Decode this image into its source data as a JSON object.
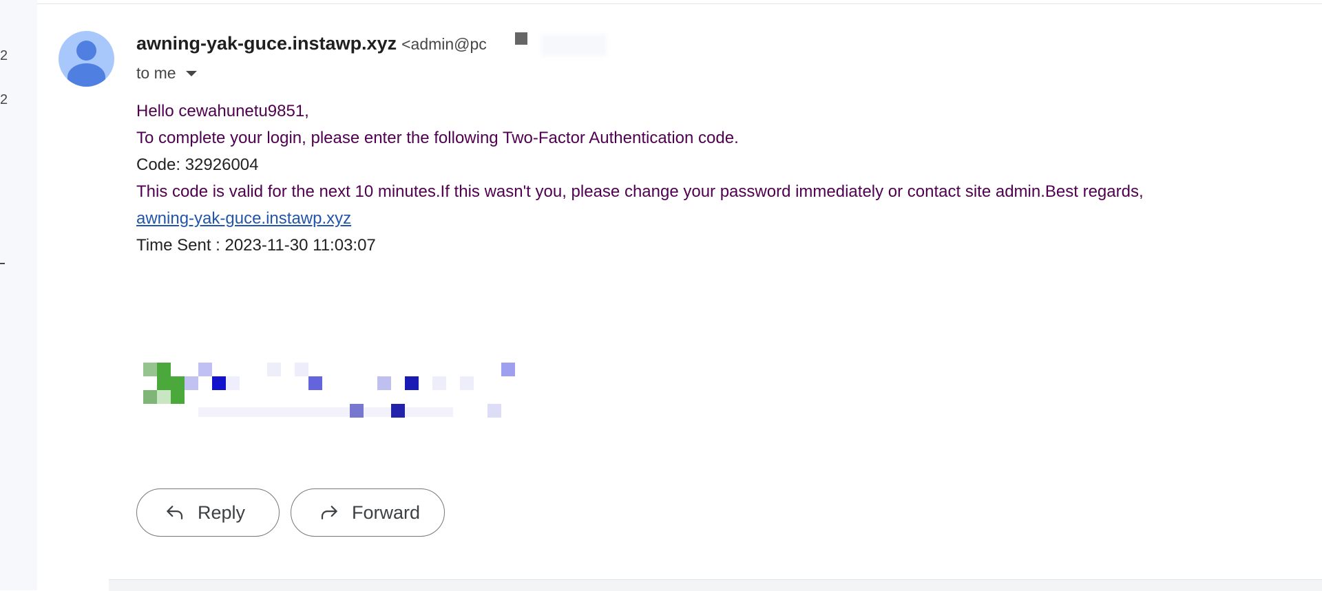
{
  "sidebar": {
    "marks": [
      "2",
      "2"
    ]
  },
  "email": {
    "sender_name": "awning-yak-guce.instawp.xyz",
    "sender_email": "<admin@pc",
    "recipient_label": "to me",
    "body": {
      "greeting": "Hello cewahunetu9851,",
      "instruction": "To complete your login, please enter the following Two-Factor Authentication code.",
      "code_line": "Code: 32926004",
      "validity": "This code is valid for the next 10 minutes.If this wasn't you, please change your password immediately or contact site admin.Best regards,",
      "site_link": "awning-yak-guce.instawp.xyz",
      "time_sent": "Time Sent : 2023-11-30 11:03:07"
    }
  },
  "actions": {
    "reply_label": "Reply",
    "forward_label": "Forward"
  },
  "icons": {
    "avatar": "person-avatar-icon",
    "recipient_caret": "caret-down-icon",
    "reply": "reply-arrow-icon",
    "forward": "forward-arrow-icon"
  },
  "colors": {
    "avatar_bg": "#a8c7fa",
    "avatar_fg": "#4f7fe0",
    "body_text": "#500050",
    "link": "#2255aa"
  }
}
